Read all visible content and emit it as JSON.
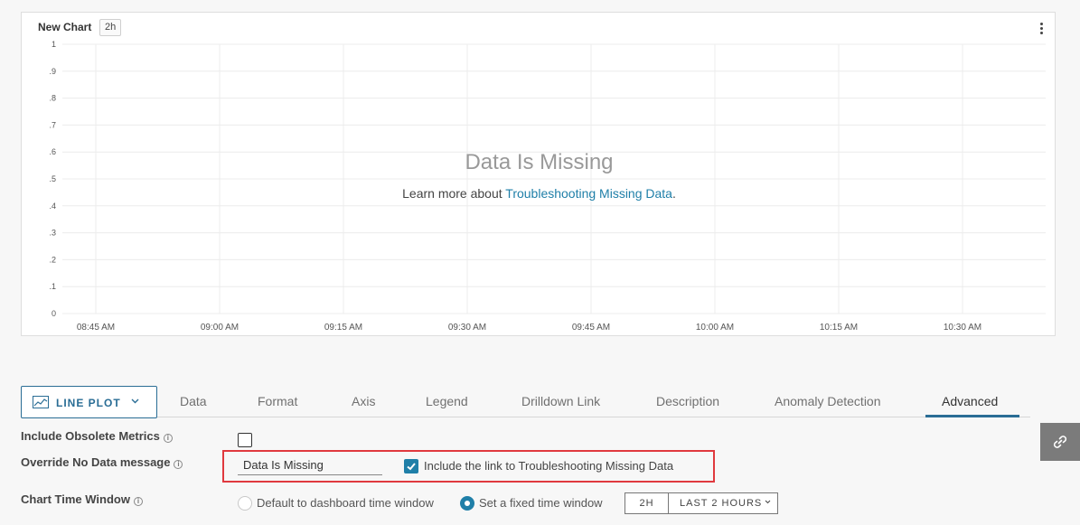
{
  "chart": {
    "title": "New Chart",
    "badge": "2h",
    "missing_title": "Data Is Missing",
    "missing_text": "Learn more about ",
    "missing_link": "Troubleshooting Missing Data",
    "missing_period": "."
  },
  "chart_data": {
    "type": "line",
    "title": "New Chart",
    "y_ticks": [
      "1",
      ".9",
      ".8",
      ".7",
      ".6",
      ".5",
      ".4",
      ".3",
      ".2",
      ".1",
      "0"
    ],
    "x_ticks": [
      "08:45 AM",
      "09:00 AM",
      "09:15 AM",
      "09:30 AM",
      "09:45 AM",
      "10:00 AM",
      "10:15 AM",
      "10:30 AM"
    ],
    "ylim": [
      0,
      1
    ],
    "series": [],
    "grid": true
  },
  "tabs": {
    "lineplot": "LINE PLOT",
    "items": [
      "Data",
      "Format",
      "Axis",
      "Legend",
      "Drilldown Link",
      "Description",
      "Anomaly Detection",
      "Advanced"
    ],
    "active": "Advanced"
  },
  "form": {
    "obsolete_label": "Include Obsolete Metrics",
    "override_label": "Override No Data message",
    "override_value": "Data Is Missing",
    "include_link_label": "Include the link to Troubleshooting Missing Data",
    "time_window_label": "Chart Time Window",
    "radio_default": "Default to dashboard time window",
    "radio_fixed": "Set a fixed time window",
    "seg_2h": "2H",
    "seg_last": "LAST 2 HOURS"
  },
  "colors": {
    "accent": "#2a6d95",
    "link": "#1f7fa8",
    "highlight": "#e0393e"
  }
}
